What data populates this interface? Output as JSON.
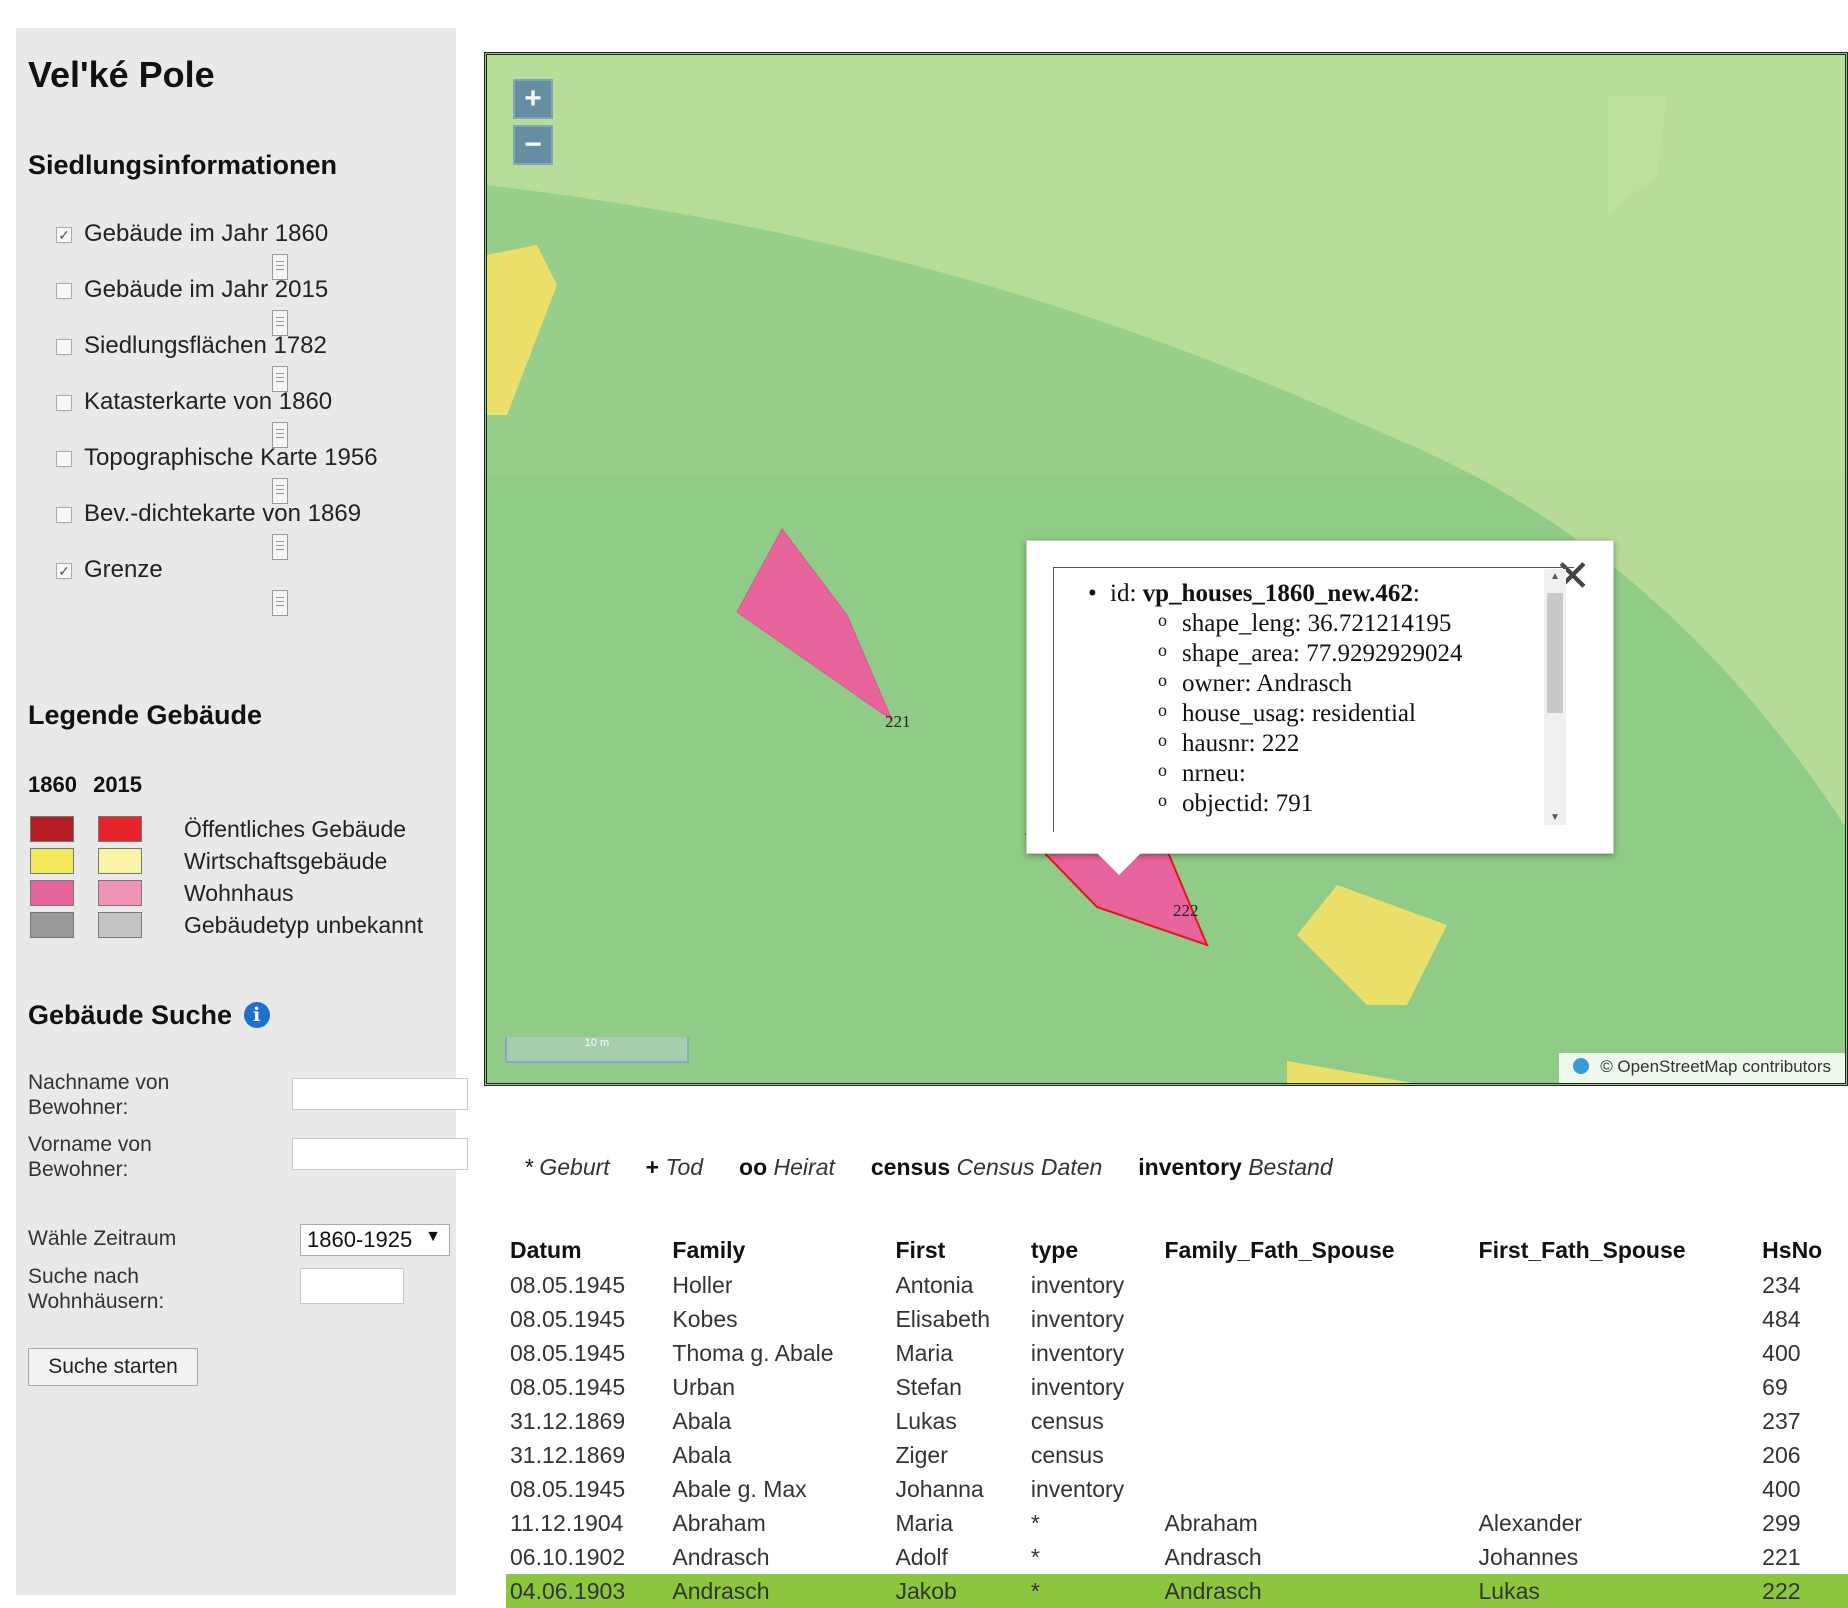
{
  "site": {
    "title": "Vel'ké Pole"
  },
  "settlement": {
    "heading": "Siedlungsinformationen",
    "layers": [
      {
        "label": "Gebäude im Jahr 1860",
        "checked": true
      },
      {
        "label": "Gebäude im Jahr 2015",
        "checked": false
      },
      {
        "label": "Siedlungsflächen 1782",
        "checked": false
      },
      {
        "label": "Katasterkarte von 1860",
        "checked": false
      },
      {
        "label": "Topographische Karte 1956",
        "checked": false
      },
      {
        "label": "Bev.-dichtekarte von 1869",
        "checked": false
      },
      {
        "label": "Grenze",
        "checked": true
      }
    ]
  },
  "legend": {
    "heading": "Legende Gebäude",
    "year_a": "1860",
    "year_b": "2015",
    "rows": [
      {
        "label": "Öffentliches Gebäude",
        "color_1860": "#b21e24",
        "color_2015": "#e8242b"
      },
      {
        "label": "Wirtschaftsgebäude",
        "color_1860": "#f2e85a",
        "color_2015": "#fbf3a6"
      },
      {
        "label": "Wohnhaus",
        "color_1860": "#e8649c",
        "color_2015": "#ef93b7"
      },
      {
        "label": "Gebäudetyp unbekannt",
        "color_1860": "#9a9a9a",
        "color_2015": "#c4c4c4"
      }
    ]
  },
  "search": {
    "heading": "Gebäude Suche",
    "lastname_label": "Nachname von Bewohner:",
    "lastname_value": "",
    "firstname_label": "Vorname von Bewohner:",
    "firstname_value": "",
    "period_label": "Wähle Zeitraum",
    "period_value": "1860-1925",
    "house_label": "Suche nach Wohnhäusern:",
    "house_value": "",
    "submit_label": "Suche starten"
  },
  "map": {
    "zoom_in": "+",
    "zoom_out": "−",
    "scale_label": "10 m",
    "attribution": "© OpenStreetMap contributors",
    "house_label_a": "221",
    "house_label_b": "222",
    "popup": {
      "close": "✕",
      "id_prefix": "id: ",
      "id_value": "vp_houses_1860_new.462",
      "id_suffix": ":",
      "props": [
        "shape_leng: 36.721214195",
        "shape_area: 77.9292929024",
        "owner: Andrasch",
        "house_usag: residential",
        "hausnr: 222",
        "nrneu:",
        "objectid: 791"
      ]
    }
  },
  "event_legend": [
    {
      "sym": "*",
      "desc": "Geburt",
      "sym_style": "plain"
    },
    {
      "sym": "+",
      "desc": "Tod",
      "sym_style": "bold"
    },
    {
      "sym": "oo",
      "desc": "Heirat",
      "sym_style": "bold"
    },
    {
      "sym": "census",
      "desc": "Census Daten",
      "sym_style": "bold"
    },
    {
      "sym": "inventory",
      "desc": "Bestand",
      "sym_style": "bold"
    }
  ],
  "results": {
    "columns": [
      "Datum",
      "Family",
      "First",
      "type",
      "Family_Fath_Spouse",
      "First_Fath_Spouse",
      "HsNo"
    ],
    "rows": [
      [
        "08.05.1945",
        "Holler",
        "Antonia",
        "inventory",
        "",
        "",
        "234"
      ],
      [
        "08.05.1945",
        "Kobes",
        "Elisabeth",
        "inventory",
        "",
        "",
        "484"
      ],
      [
        "08.05.1945",
        "Thoma g. Abale",
        "Maria",
        "inventory",
        "",
        "",
        "400"
      ],
      [
        "08.05.1945",
        "Urban",
        "Stefan",
        "inventory",
        "",
        "",
        "69"
      ],
      [
        "31.12.1869",
        "Abala",
        "Lukas",
        "census",
        "",
        "",
        "237"
      ],
      [
        "31.12.1869",
        "Abala",
        "Ziger",
        "census",
        "",
        "",
        "206"
      ],
      [
        "08.05.1945",
        "Abale g. Max",
        "Johanna",
        "inventory",
        "",
        "",
        "400"
      ],
      [
        "11.12.1904",
        "Abraham",
        "Maria",
        "*",
        "Abraham",
        "Alexander",
        "299"
      ],
      [
        "06.10.1902",
        "Andrasch",
        "Adolf",
        "*",
        "Andrasch",
        "Johannes",
        "221"
      ],
      [
        "04.06.1903",
        "Andrasch",
        "Jakob",
        "*",
        "Andrasch",
        "Lukas",
        "222"
      ]
    ],
    "selected_row": 9
  }
}
